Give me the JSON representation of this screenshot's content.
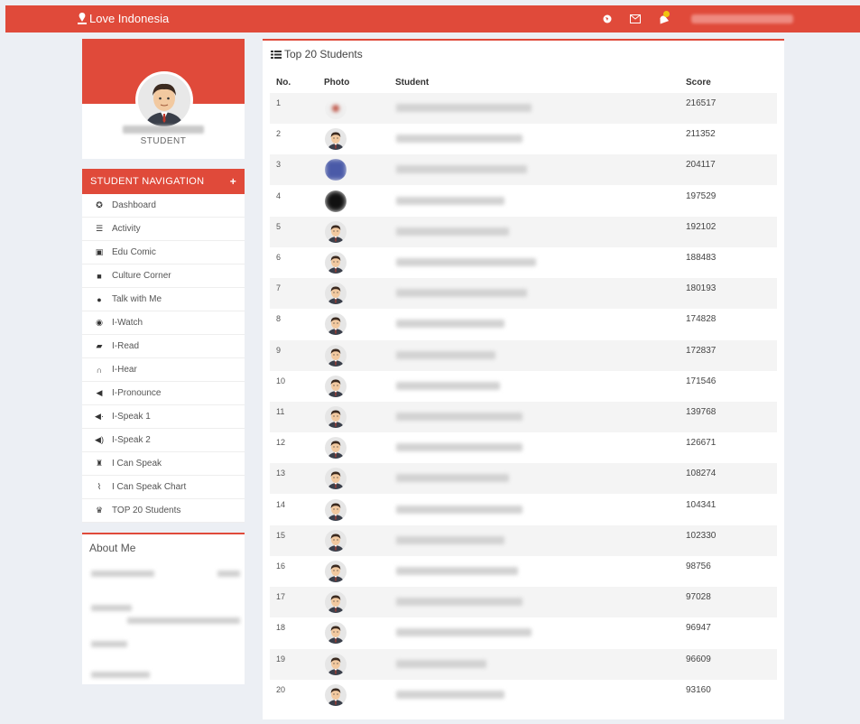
{
  "app": {
    "brand": "Love Indonesia"
  },
  "topbar": {
    "icons": [
      "globe-icon",
      "mail-icon",
      "bell-icon"
    ]
  },
  "profile": {
    "role": "STUDENT"
  },
  "nav": {
    "header": "STUDENT NAVIGATION",
    "expand": "+",
    "items": [
      {
        "label": "Dashboard",
        "icon": "dashboard-icon",
        "glyph": "✪"
      },
      {
        "label": "Activity",
        "icon": "list-icon",
        "glyph": "☰"
      },
      {
        "label": "Edu Comic",
        "icon": "picture-icon",
        "glyph": "▣"
      },
      {
        "label": "Culture Corner",
        "icon": "video-camera-icon",
        "glyph": "■"
      },
      {
        "label": "Talk with Me",
        "icon": "chat-icon",
        "glyph": "●"
      },
      {
        "label": "I-Watch",
        "icon": "eye-icon",
        "glyph": "◉"
      },
      {
        "label": "I-Read",
        "icon": "book-icon",
        "glyph": "▰"
      },
      {
        "label": "I-Hear",
        "icon": "headphones-icon",
        "glyph": "∩"
      },
      {
        "label": "I-Pronounce",
        "icon": "speaker-off-icon",
        "glyph": "◀"
      },
      {
        "label": "I-Speak 1",
        "icon": "speaker-low-icon",
        "glyph": "◀·"
      },
      {
        "label": "I-Speak 2",
        "icon": "speaker-high-icon",
        "glyph": "◀)"
      },
      {
        "label": "I Can Speak",
        "icon": "trophy-icon",
        "glyph": "♜"
      },
      {
        "label": "I Can Speak Chart",
        "icon": "line-chart-icon",
        "glyph": "⌇"
      },
      {
        "label": "TOP 20 Students",
        "icon": "trophy-icon",
        "glyph": "♛"
      }
    ]
  },
  "about": {
    "title": "About Me"
  },
  "main": {
    "title": "Top 20 Students",
    "columns": [
      "No.",
      "Photo",
      "Student",
      "Score"
    ],
    "rows": [
      {
        "no": "1",
        "score": "216517"
      },
      {
        "no": "2",
        "score": "211352"
      },
      {
        "no": "3",
        "score": "204117"
      },
      {
        "no": "4",
        "score": "197529"
      },
      {
        "no": "5",
        "score": "192102"
      },
      {
        "no": "6",
        "score": "188483"
      },
      {
        "no": "7",
        "score": "180193"
      },
      {
        "no": "8",
        "score": "174828"
      },
      {
        "no": "9",
        "score": "172837"
      },
      {
        "no": "10",
        "score": "171546"
      },
      {
        "no": "11",
        "score": "139768"
      },
      {
        "no": "12",
        "score": "126671"
      },
      {
        "no": "13",
        "score": "108274"
      },
      {
        "no": "14",
        "score": "104341"
      },
      {
        "no": "15",
        "score": "102330"
      },
      {
        "no": "16",
        "score": "98756"
      },
      {
        "no": "17",
        "score": "97028"
      },
      {
        "no": "18",
        "score": "96947"
      },
      {
        "no": "19",
        "score": "96609"
      },
      {
        "no": "20",
        "score": "93160"
      }
    ]
  },
  "colors": {
    "accent": "#e04a3a",
    "background": "#eceff4"
  }
}
